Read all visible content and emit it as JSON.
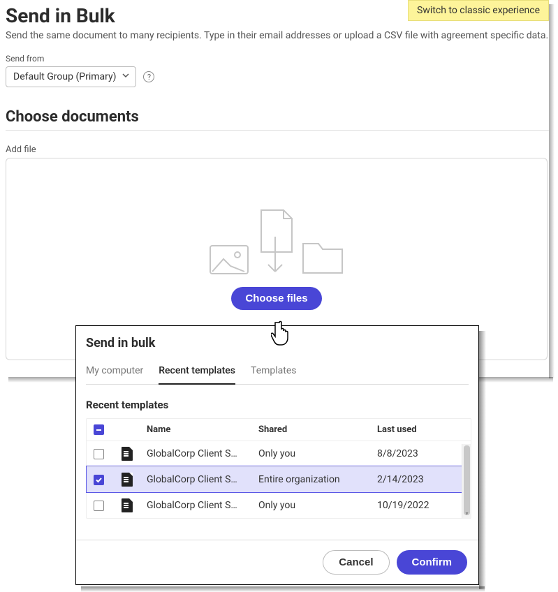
{
  "header": {
    "title": "Send in Bulk",
    "subtitle": "Send the same document to many recipients. Type in their email addresses or upload a CSV file with agreement specific data.",
    "classic_switch": "Switch to classic experience"
  },
  "send_from": {
    "label": "Send from",
    "selected": "Default Group (Primary)"
  },
  "docs_section": {
    "title": "Choose documents",
    "add_file_label": "Add file",
    "choose_button": "Choose files"
  },
  "dialog": {
    "title": "Send in bulk",
    "tabs": {
      "my_computer": "My computer",
      "recent_templates": "Recent templates",
      "templates": "Templates"
    },
    "body_title": "Recent templates",
    "columns": {
      "name": "Name",
      "shared": "Shared",
      "last_used": "Last used"
    },
    "rows": [
      {
        "name": "GlobalCorp Client S…",
        "shared": "Only you",
        "last_used": "8/8/2023",
        "checked": false
      },
      {
        "name": "GlobalCorp Client S…",
        "shared": "Entire organization",
        "last_used": "2/14/2023",
        "checked": true
      },
      {
        "name": "GlobalCorp Client S…",
        "shared": "Only you",
        "last_used": "10/19/2022",
        "checked": false
      }
    ],
    "footer": {
      "cancel": "Cancel",
      "confirm": "Confirm"
    }
  }
}
